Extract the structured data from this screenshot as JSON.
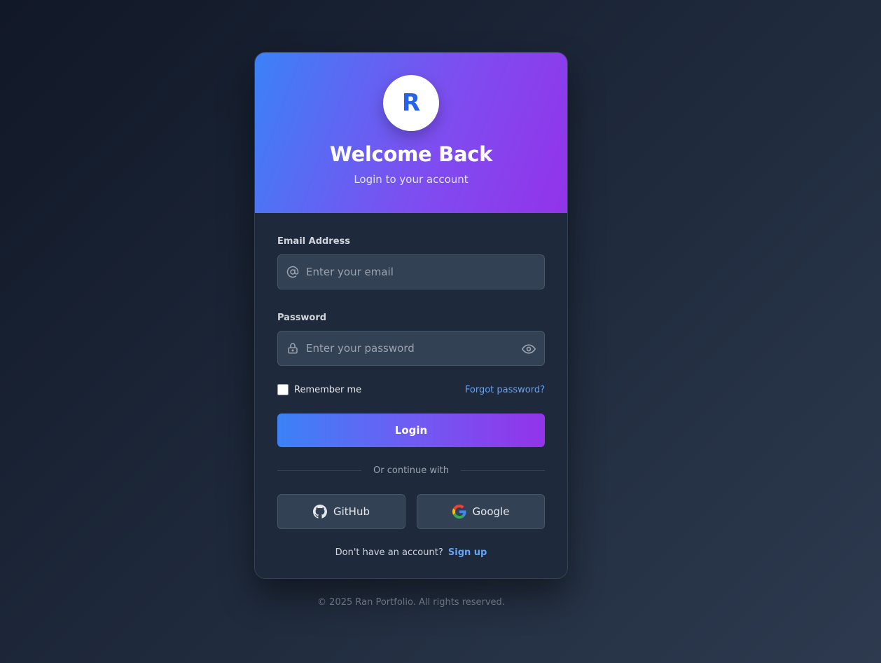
{
  "header": {
    "logo_letter": "R",
    "title": "Welcome Back",
    "subtitle": "Login to your account"
  },
  "form": {
    "email": {
      "label": "Email Address",
      "placeholder": "Enter your email",
      "icon": "at-icon"
    },
    "password": {
      "label": "Password",
      "placeholder": "Enter your password",
      "icon": "lock-icon",
      "toggle_icon": "eye-icon"
    },
    "remember_label": "Remember me",
    "forgot_label": "Forgot password?",
    "login_label": "Login",
    "divider_label": "Or continue with"
  },
  "social": [
    {
      "label": "GitHub",
      "icon": "github-icon"
    },
    {
      "label": "Google",
      "icon": "google-icon"
    }
  ],
  "signup": {
    "prompt": "Don't have an account?",
    "link": "Sign up"
  },
  "footer": {
    "copyright": "© 2025 Ran Portfolio. All rights reserved."
  },
  "colors": {
    "accent_blue": "#3b82f6",
    "accent_purple": "#9333ea",
    "link": "#60a5fa",
    "card_bg": "#1e293b",
    "input_bg": "#334155"
  }
}
